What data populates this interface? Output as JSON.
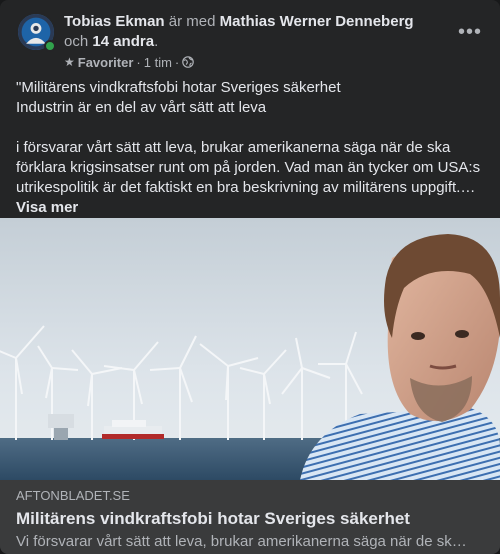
{
  "post": {
    "author": "Tobias Ekman",
    "with_text": "är med",
    "tagged": "Mathias Werner Denneberg",
    "and_text": "och",
    "others": "14 andra",
    "period": ".",
    "audience": "Favoriter",
    "separator": "·",
    "time": "1 tim",
    "separator2": "·",
    "more_label": "•••",
    "text_line1": "\"Militärens vindkraftsfobi hotar Sveriges säkerhet",
    "text_line2": "Industrin är en del av vårt sätt att leva",
    "text_line3": "i försvarar vårt sätt att leva, brukar amerikanerna säga när de ska",
    "text_line4": "förklara krigsinsatser runt om på jorden. Vad man än tycker om USA:s",
    "text_line5": "utrikespolitik är det faktiskt en bra beskrivning av militärens uppgift.…",
    "see_more": "Visa mer"
  },
  "link": {
    "domain": "AFTONBLADET.SE",
    "title": "Militärens vindkraftsfobi hotar Sveriges säkerhet",
    "description": "Vi försvarar vårt sätt att leva, brukar amerikanerna säga när de sk…"
  },
  "icons": {
    "avatar": "avatar-icon",
    "star": "star-icon",
    "globe": "globe-icon",
    "more": "more-options-icon"
  },
  "colors": {
    "card_bg": "#242526",
    "link_bg": "#3a3b3c",
    "text_primary": "#e4e6eb",
    "text_secondary": "#b0b3b8",
    "online": "#31a24c"
  }
}
